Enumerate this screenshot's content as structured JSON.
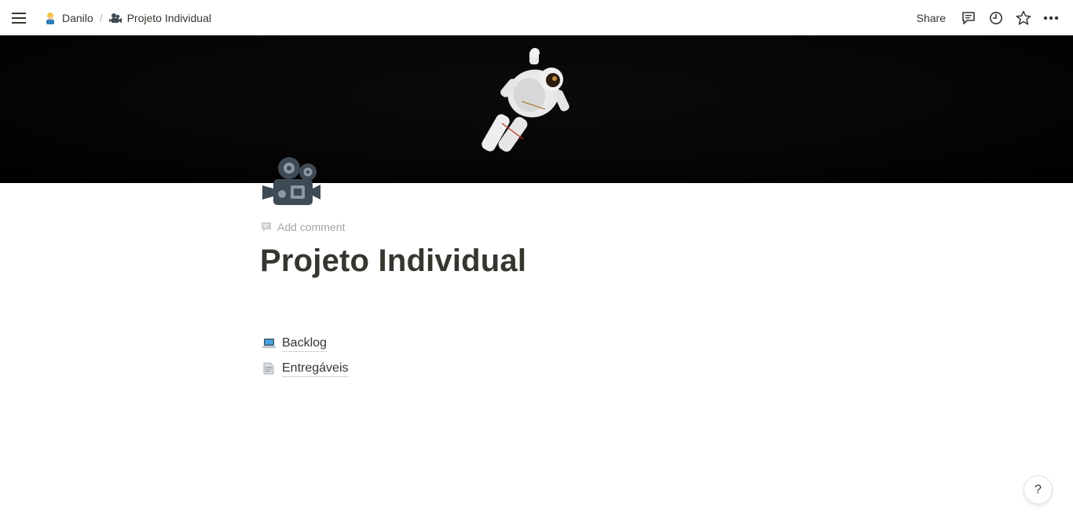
{
  "topbar": {
    "menu_icon": "hamburger-icon",
    "breadcrumbs": [
      {
        "label": "Danilo",
        "icon": "person-emoji-icon"
      },
      {
        "label": "Projeto Individual",
        "icon": "movie-camera-icon"
      }
    ],
    "separator": "/",
    "share_label": "Share",
    "actions": [
      "comments-icon",
      "history-icon",
      "favorite-star-icon",
      "more-icon"
    ]
  },
  "page": {
    "cover": "astronaut-space-cover",
    "icon": "movie-camera-icon",
    "add_comment": "Add comment",
    "title": "Projeto Individual",
    "links": [
      {
        "label": "Backlog",
        "icon": "laptop-icon"
      },
      {
        "label": "Entregáveis",
        "icon": "page-icon"
      }
    ]
  },
  "help": {
    "label": "?"
  }
}
